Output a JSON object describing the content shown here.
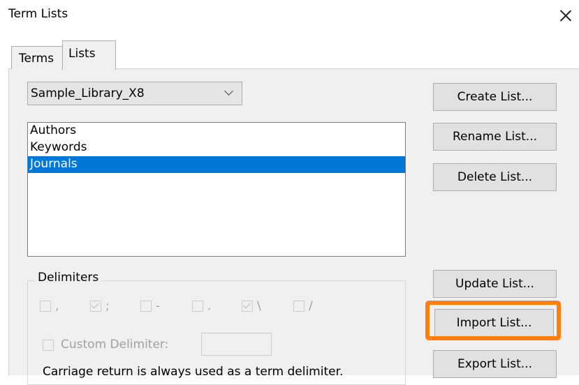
{
  "window": {
    "title": "Term Lists"
  },
  "tabs": [
    {
      "label": "Terms"
    },
    {
      "label": "Lists"
    }
  ],
  "library_select": {
    "value": "Sample_Library_X8"
  },
  "lists": [
    "Authors",
    "Keywords",
    "Journals"
  ],
  "buttons": {
    "create": "Create List...",
    "rename": "Rename List...",
    "delete": "Delete List...",
    "update": "Update List...",
    "import": "Import List...",
    "export": "Export List..."
  },
  "delimiters": {
    "label": "Delimiters",
    "items": [
      {
        "symbol": ",",
        "checked": false
      },
      {
        "symbol": ";",
        "checked": true
      },
      {
        "symbol": "-",
        "checked": false
      },
      {
        "symbol": ".",
        "checked": false
      },
      {
        "symbol": "\\",
        "checked": true
      },
      {
        "symbol": "/",
        "checked": false
      }
    ],
    "custom_label": "Custom Delimiter:",
    "custom_value": "",
    "note": "Carriage return is always used as a term delimiter."
  },
  "highlight_color": "#ff7f0e",
  "selection_color": "#0078d7"
}
